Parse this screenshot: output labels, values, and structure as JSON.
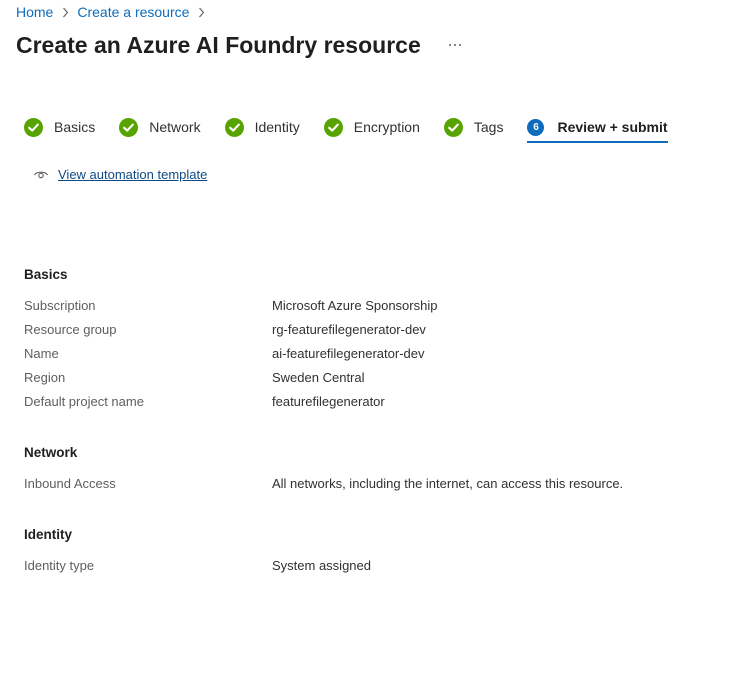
{
  "breadcrumb": {
    "items": [
      "Home",
      "Create a resource"
    ]
  },
  "page": {
    "title": "Create an Azure AI Foundry resource",
    "more_label": "···"
  },
  "tabs": [
    {
      "label": "Basics",
      "status": "complete"
    },
    {
      "label": "Network",
      "status": "complete"
    },
    {
      "label": "Identity",
      "status": "complete"
    },
    {
      "label": "Encryption",
      "status": "complete"
    },
    {
      "label": "Tags",
      "status": "complete"
    },
    {
      "label": "Review + submit",
      "status": "active",
      "step": "6"
    }
  ],
  "automation": {
    "link_label": "View automation template"
  },
  "sections": {
    "basics": {
      "heading": "Basics",
      "rows": [
        {
          "label": "Subscription",
          "value": "Microsoft Azure Sponsorship"
        },
        {
          "label": "Resource group",
          "value": "rg-featurefilegenerator-dev"
        },
        {
          "label": "Name",
          "value": "ai-featurefilegenerator-dev"
        },
        {
          "label": "Region",
          "value": "Sweden Central"
        },
        {
          "label": "Default project name",
          "value": "featurefilegenerator"
        }
      ]
    },
    "network": {
      "heading": "Network",
      "rows": [
        {
          "label": "Inbound Access",
          "value": "All networks, including the internet, can access this resource."
        }
      ]
    },
    "identity": {
      "heading": "Identity",
      "rows": [
        {
          "label": "Identity type",
          "value": "System assigned"
        }
      ]
    }
  },
  "colors": {
    "accent": "#0f6cbd",
    "success": "#57a300",
    "link_dark": "#0f4a85"
  },
  "icons": {
    "complete": "check-circle-icon",
    "view": "eye-icon",
    "separator": "chevron-right-icon",
    "more": "more-horizontal-icon"
  }
}
